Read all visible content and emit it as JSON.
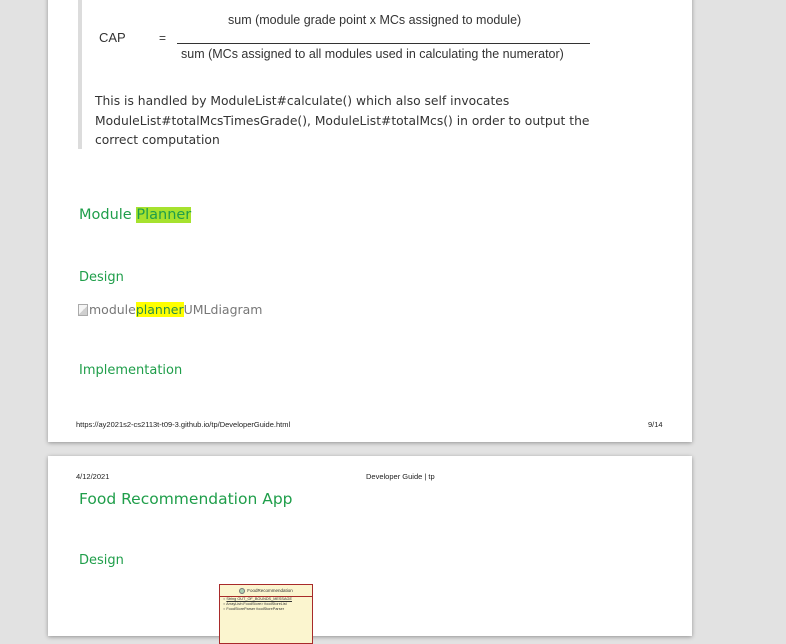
{
  "page1": {
    "formula": {
      "lhs": "CAP",
      "equals": "=",
      "numerator": "sum (module grade point x MCs assigned to module)",
      "denominator": "sum (MCs assigned to all modules used in calculating the numerator)"
    },
    "paragraph": "This is handled by ModuleList#calculate() which also self invocates ModuleList#totalMcsTimesGrade(), ModuleList#totalMcs() in order to output the correct computation",
    "heading_module": "Module",
    "heading_planner": "Planner",
    "heading_design": "Design",
    "image_alt_prefix": "module",
    "image_alt_highlight": "planner",
    "image_alt_suffix": "UMLdiagram",
    "heading_implementation": "Implementation",
    "footer_url": "https://ay2021s2-cs2113t-t09-3.github.io/tp/DeveloperGuide.html",
    "footer_page": "9/14"
  },
  "page2": {
    "header_date": "4/12/2021",
    "header_title": "Developer Guide | tp",
    "heading_food": "Food Recommendation App",
    "heading_design": "Design",
    "uml": {
      "class_name": "FoodRecommendation",
      "rows": [
        "String OUT_OF_BOUNDS_MESSAGE",
        "ArrayList<FoodStore> foodStoreList",
        "FoodStoreParser foodStoreParser"
      ]
    }
  },
  "colors": {
    "heading_green": "#1f9e4a",
    "highlight_green": "#a6e22e",
    "highlight_yellow": "#ffff00"
  }
}
